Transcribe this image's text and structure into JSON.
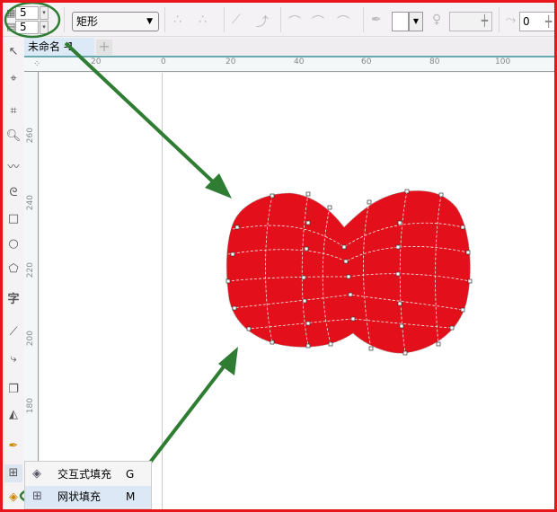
{
  "property_bar": {
    "mesh_columns": "5",
    "mesh_rows": "5",
    "selection_mode": "矩形",
    "transparency_value": "0"
  },
  "document_tab": {
    "title": "未命名 -1",
    "add_tab_icon": "plus-icon"
  },
  "ruler": {
    "horizontal_labels": [
      "20",
      "0",
      "20",
      "40",
      "60",
      "80",
      "100"
    ],
    "vertical_labels": [
      "260",
      "240",
      "220",
      "200",
      "180"
    ]
  },
  "flyout_menu": {
    "items": [
      {
        "label": "交互式填充",
        "shortcut": "G",
        "icon": "interactive-fill-icon"
      },
      {
        "label": "网状填充",
        "shortcut": "M",
        "icon": "mesh-fill-icon",
        "selected": true
      }
    ]
  },
  "colors": {
    "shape_fill": "#e3101b",
    "annotation": "#2e7d32",
    "frame": "#e8161c"
  }
}
